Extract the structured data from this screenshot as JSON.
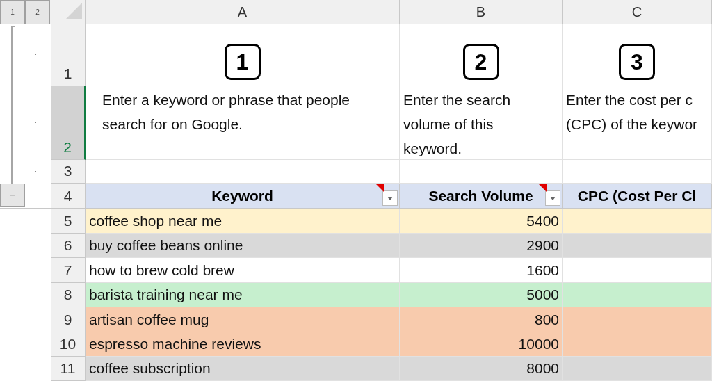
{
  "outline": {
    "levels": [
      "1",
      "2"
    ],
    "collapse_button": "−"
  },
  "columns": [
    {
      "label": "A"
    },
    {
      "label": "B"
    },
    {
      "label": "C"
    }
  ],
  "row_headers": [
    {
      "label": "1",
      "selected": false
    },
    {
      "label": "2",
      "selected": true
    },
    {
      "label": "3",
      "selected": false
    },
    {
      "label": "4",
      "selected": false
    },
    {
      "label": "5",
      "selected": false
    },
    {
      "label": "6",
      "selected": false
    },
    {
      "label": "7",
      "selected": false
    },
    {
      "label": "8",
      "selected": false
    },
    {
      "label": "9",
      "selected": false
    },
    {
      "label": "10",
      "selected": false
    },
    {
      "label": "11",
      "selected": false
    }
  ],
  "steps": [
    {
      "number": "1",
      "lines": [
        "Enter a keyword or phrase that people",
        "search for on Google."
      ]
    },
    {
      "number": "2",
      "lines": [
        "Enter the search",
        "volume of this",
        "keyword."
      ]
    },
    {
      "number": "3",
      "lines": [
        "Enter the cost per c",
        "(CPC) of the keywor"
      ]
    }
  ],
  "table_header": [
    {
      "text": "Keyword",
      "filter": true,
      "comment": true
    },
    {
      "text": "Search Volume",
      "filter": true,
      "comment": true
    },
    {
      "text": "CPC (Cost Per Cl",
      "filter": false,
      "comment": false
    }
  ],
  "rows": [
    {
      "keyword": "coffee shop near me",
      "volume": "5400",
      "color": "#fff2cc"
    },
    {
      "keyword": "buy coffee beans online",
      "volume": "2900",
      "color": "#d9d9d9"
    },
    {
      "keyword": "how to brew cold brew",
      "volume": "1600",
      "color": "#ffffff"
    },
    {
      "keyword": "barista training near me",
      "volume": "5000",
      "color": "#c6efce"
    },
    {
      "keyword": "artisan coffee mug",
      "volume": "800",
      "color": "#f8cbad"
    },
    {
      "keyword": "espresso machine reviews",
      "volume": "10000",
      "color": "#f8cbad"
    },
    {
      "keyword": "coffee subscription",
      "volume": "8000",
      "color": "#d9d9d9"
    }
  ]
}
